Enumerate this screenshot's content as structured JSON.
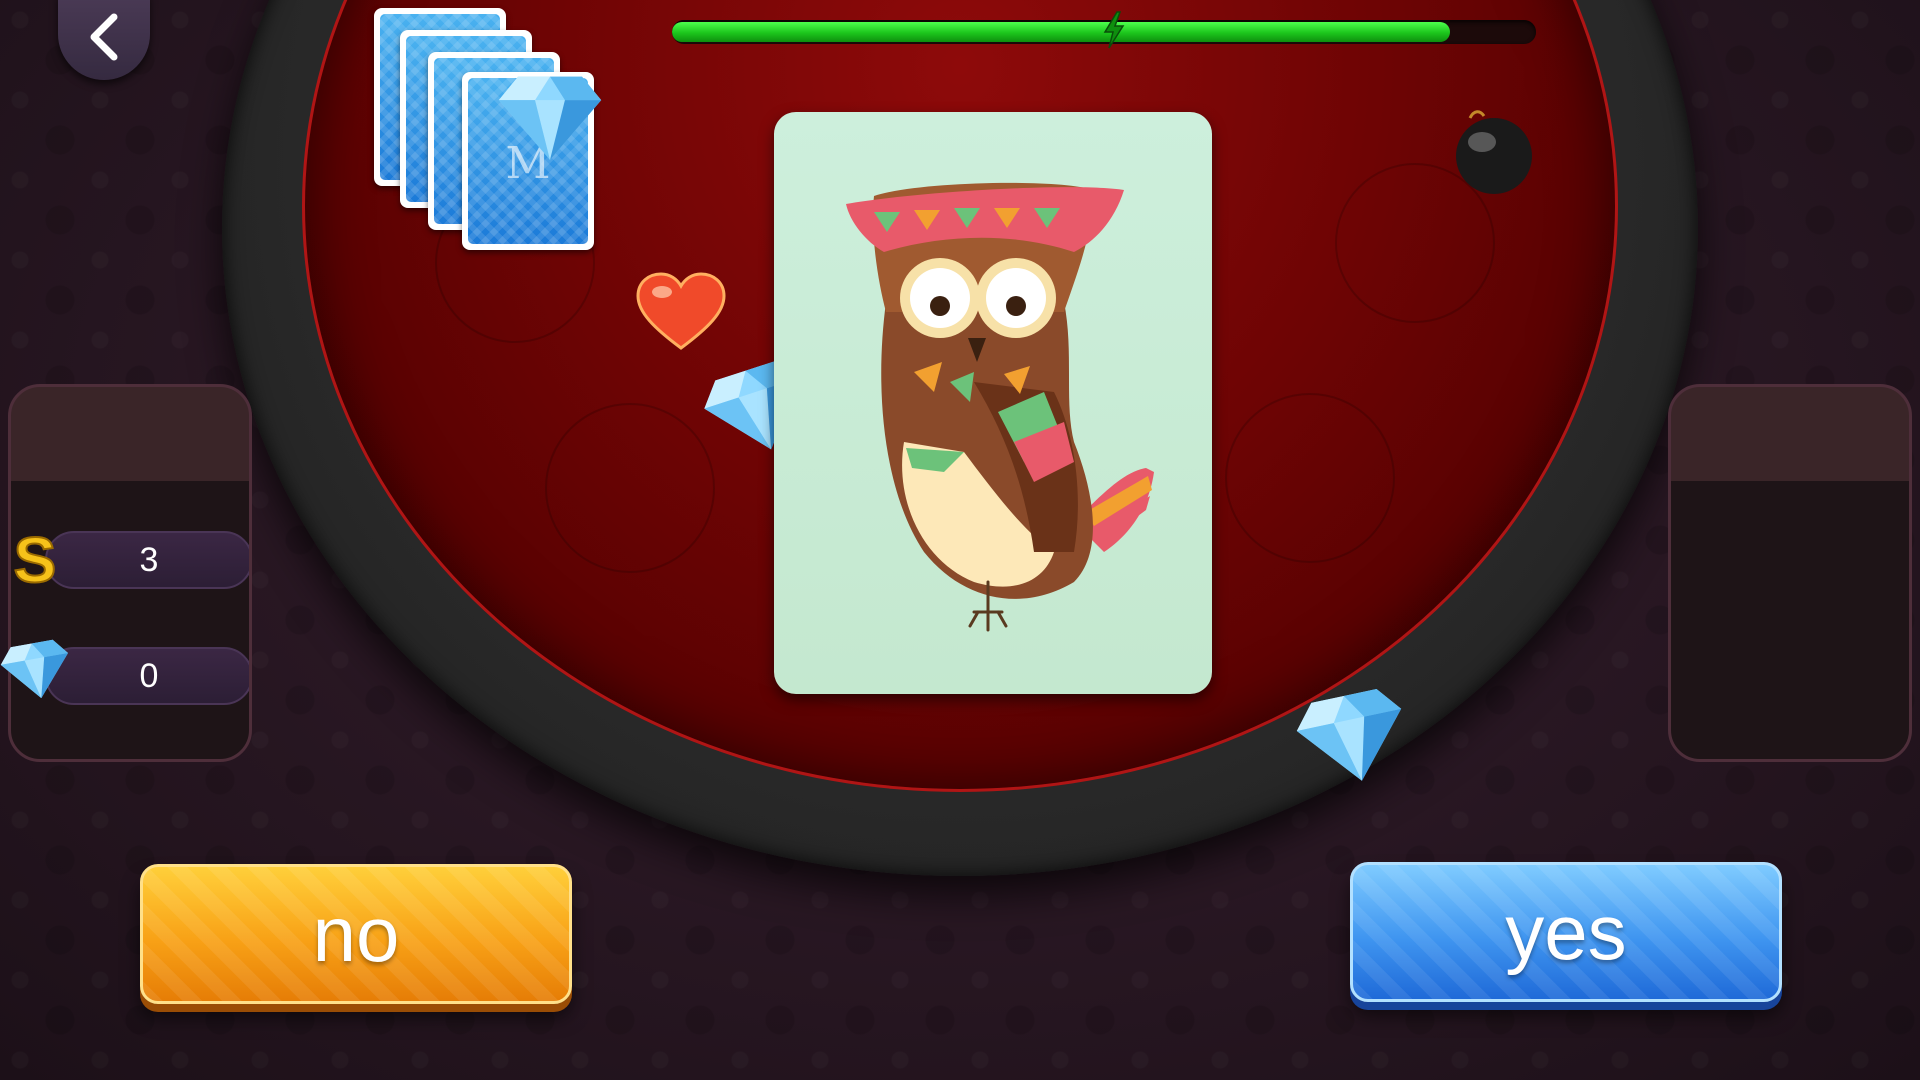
{
  "hud": {
    "energy_percent": 90,
    "coins": "3",
    "gems": "0"
  },
  "deck": {
    "back_letter": "M"
  },
  "card": {
    "image": "owl"
  },
  "buttons": {
    "no_label": "no",
    "yes_label": "yes"
  },
  "colors": {
    "no_button": "#f8a116",
    "yes_button": "#3f95f0",
    "energy": "#1cc51c",
    "felt": "#6e0404"
  },
  "icons": [
    "back-chevron-icon",
    "lightning-bolt-icon",
    "heart-icon",
    "diamond-gem-icon",
    "bomb-icon",
    "coin-s-icon"
  ]
}
